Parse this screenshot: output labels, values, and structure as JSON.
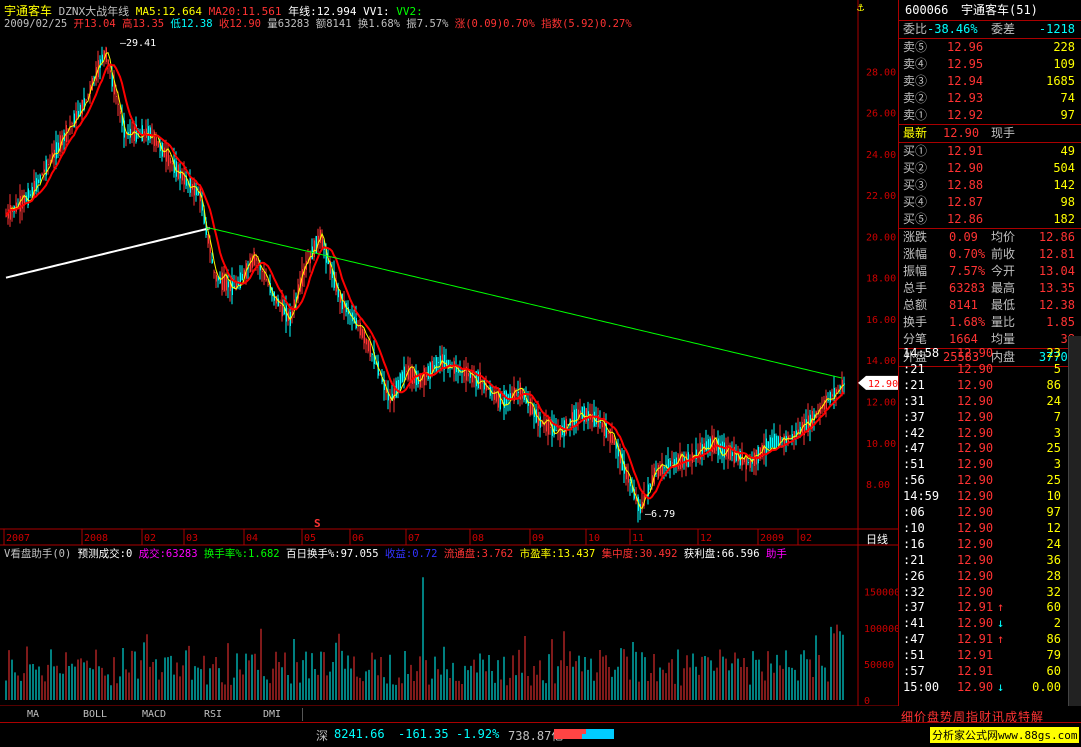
{
  "title": "宇通客车",
  "indicator_bar": {
    "name": "DZNX大战年线",
    "ma5": "MA5:12.664",
    "ma20": "MA20:11.561",
    "yearline": "年线:12.994",
    "vv1": "VV1:",
    "vv2": "VV2:"
  },
  "ohlc_bar": {
    "date": "2009/02/25",
    "open": "开13.04",
    "high": "高13.35",
    "low": "低12.38",
    "close": "收12.90",
    "volume": "量63283",
    "amount": "额8141",
    "turnover": "换1.68%",
    "amplitude": "振7.57%",
    "change": "涨(0.09)0.70%",
    "index": "指数(5.92)0.27%"
  },
  "price_axis": [
    "28.00",
    "26.00",
    "24.00",
    "22.00",
    "20.00",
    "18.00",
    "16.00",
    "14.00",
    "12.00",
    "10.00",
    "8.00"
  ],
  "price_marker": "12.90",
  "annotations": {
    "high": "29.41",
    "low": "6.79",
    "signal": "S"
  },
  "time_axis": [
    "2007",
    "2008",
    "02",
    "03",
    "04",
    "05",
    "06",
    "07",
    "08",
    "09",
    "10",
    "11",
    "12",
    "2009",
    "02"
  ],
  "period_label": "日线",
  "volume_header": {
    "name": "V看盘助手(0)",
    "predict": "预测成交:0",
    "vol": "成交:63283",
    "turn": "换手率%:1.682",
    "bairi": "百日换手%:97.055",
    "shouyi": "收益:0.72",
    "liutong": "流通盘:3.762",
    "pe": "市盈率:13.437",
    "jizhong": "集中度:30.492",
    "huoli": "获利盘:66.596",
    "zhushou": "助手"
  },
  "volume_axis": [
    "150000",
    "100000",
    "50000",
    "0"
  ],
  "tabs": [
    "MA",
    "BOLL",
    "MACD",
    "RSI",
    "DMI"
  ],
  "side": {
    "code": "600066",
    "name": "宇通客车(51)",
    "weibi": "委比",
    "weibi_val": "-38.46%",
    "weicha": "委差",
    "weicha_val": "-1218",
    "sells": [
      {
        "label": "卖⑤",
        "price": "12.96",
        "vol": "228"
      },
      {
        "label": "卖④",
        "price": "12.95",
        "vol": "109"
      },
      {
        "label": "卖③",
        "price": "12.94",
        "vol": "1685"
      },
      {
        "label": "卖②",
        "price": "12.93",
        "vol": "74"
      },
      {
        "label": "卖①",
        "price": "12.92",
        "vol": "97"
      }
    ],
    "latest_label": "最新",
    "latest_price": "12.90",
    "current_hand": "现手",
    "buys": [
      {
        "label": "买①",
        "price": "12.91",
        "vol": "49"
      },
      {
        "label": "买②",
        "price": "12.90",
        "vol": "504"
      },
      {
        "label": "买③",
        "price": "12.88",
        "vol": "142"
      },
      {
        "label": "买④",
        "price": "12.87",
        "vol": "98"
      },
      {
        "label": "买⑤",
        "price": "12.86",
        "vol": "182"
      }
    ],
    "stats": [
      {
        "l1": "涨跌",
        "v1": "0.09",
        "l2": "均价",
        "v2": "12.86"
      },
      {
        "l1": "涨幅",
        "v1": "0.70%",
        "l2": "前收",
        "v2": "12.81"
      },
      {
        "l1": "振幅",
        "v1": "7.57%",
        "l2": "今开",
        "v2": "13.04"
      },
      {
        "l1": "总手",
        "v1": "63283",
        "l2": "最高",
        "v2": "13.35"
      },
      {
        "l1": "总额",
        "v1": "8141",
        "l2": "最低",
        "v2": "12.38"
      },
      {
        "l1": "换手",
        "v1": "1.68%",
        "l2": "量比",
        "v2": "1.85"
      },
      {
        "l1": "分笔",
        "v1": "1664",
        "l2": "均量",
        "v2": "38"
      }
    ],
    "outer_label": "外盘",
    "outer_val": "25583",
    "inner_label": "内盘",
    "inner_val": "37700",
    "ticks": [
      {
        "t": "14:58",
        "p": "12.90",
        "v": "23",
        "a": ""
      },
      {
        "t": ":21",
        "p": "12.90",
        "v": "5",
        "a": ""
      },
      {
        "t": ":21",
        "p": "12.90",
        "v": "86",
        "a": ""
      },
      {
        "t": ":31",
        "p": "12.90",
        "v": "24",
        "a": ""
      },
      {
        "t": ":37",
        "p": "12.90",
        "v": "7",
        "a": ""
      },
      {
        "t": ":42",
        "p": "12.90",
        "v": "3",
        "a": ""
      },
      {
        "t": ":47",
        "p": "12.90",
        "v": "25",
        "a": ""
      },
      {
        "t": ":51",
        "p": "12.90",
        "v": "3",
        "a": ""
      },
      {
        "t": ":56",
        "p": "12.90",
        "v": "25",
        "a": ""
      },
      {
        "t": "14:59",
        "p": "12.90",
        "v": "10",
        "a": ""
      },
      {
        "t": ":06",
        "p": "12.90",
        "v": "97",
        "a": ""
      },
      {
        "t": ":10",
        "p": "12.90",
        "v": "12",
        "a": ""
      },
      {
        "t": ":16",
        "p": "12.90",
        "v": "24",
        "a": ""
      },
      {
        "t": ":21",
        "p": "12.90",
        "v": "36",
        "a": ""
      },
      {
        "t": ":26",
        "p": "12.90",
        "v": "28",
        "a": ""
      },
      {
        "t": ":32",
        "p": "12.90",
        "v": "32",
        "a": ""
      },
      {
        "t": ":37",
        "p": "12.91",
        "v": "60",
        "a": "↑"
      },
      {
        "t": ":41",
        "p": "12.90",
        "v": "2",
        "a": "↓"
      },
      {
        "t": ":47",
        "p": "12.91",
        "v": "86",
        "a": "↑"
      },
      {
        "t": ":51",
        "p": "12.91",
        "v": "79",
        "a": ""
      },
      {
        "t": ":57",
        "p": "12.91",
        "v": "60",
        "a": ""
      },
      {
        "t": "15:00",
        "p": "12.90",
        "v": "0.00",
        "a": "↓"
      }
    ],
    "bottom_tabs": "细价盘势周指财讯成特解"
  },
  "status": {
    "market": "深",
    "index": "8241.66",
    "change": "-161.35",
    "pct": "-1.92%",
    "amount": "738.87亿",
    "site": "分析家公式网www.88gs.com"
  },
  "colors": {
    "up": "#ff3333",
    "down": "#00ffff",
    "ma_red": "#ff0000",
    "yearline_green": "#00ff00",
    "yearline_white": "#ffffff",
    "ma5": "#ffff00"
  }
}
